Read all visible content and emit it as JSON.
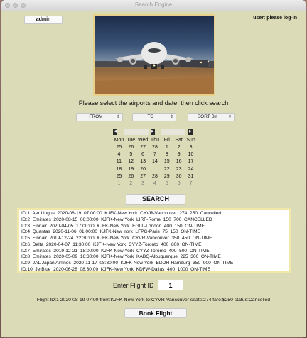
{
  "window": {
    "title": "Search Engine"
  },
  "header": {
    "admin_label": "admin",
    "user_status": "user: please log-in"
  },
  "instruction": "Please select the airports and date, then click search",
  "dropdowns": {
    "from": "FROM",
    "to": "TO",
    "sort": "SORT BY"
  },
  "calendar": {
    "weekdays": [
      "Mon",
      "Tue",
      "Wed",
      "Thu",
      "Fri",
      "Sat",
      "Sun"
    ],
    "weeks": [
      [
        "25",
        "26",
        "27",
        "28",
        "1",
        "2",
        "3"
      ],
      [
        "4",
        "5",
        "6",
        "7",
        "8",
        "9",
        "10"
      ],
      [
        "11",
        "12",
        "13",
        "14",
        "15",
        "16",
        "17"
      ],
      [
        "18",
        "19",
        "20",
        "",
        "22",
        "23",
        "24"
      ],
      [
        "25",
        "26",
        "27",
        "28",
        "29",
        "30",
        "31"
      ],
      [
        "1",
        "2",
        "3",
        "4",
        "5",
        "6",
        "7"
      ]
    ]
  },
  "search_label": "SEARCH",
  "results": [
    "ID:1  Aer Lingus  2020-08-19  07:00:00  KJFK-New York  CYVR-Vancouver  274  250  Cancelled",
    "ID:2  Emirates  2020-08-15  06:00:00  KJFK-New York  LIRF-Rome  150  700  CANCELLED",
    "ID:3  Finnair  2020-04-05  17:00:00  KJFK-New York  EGLL-London  400  150  ON-TIME",
    "ID:4  Quantas  2020-11-06  01:00:00  KJFK-New York  LFPG-Paris  75  150  ON-TIME",
    "ID:5  Finnair  2019-12-24  22:30:00  KJFK-New York  CYVR-Vancouver  350  450  ON-TIME",
    "ID:6  Delta  2020-04-07  11:30:00  KJFK-New York  CYYZ-Toronto  400  800  ON-TIME",
    "ID:7  Emirates  2019-12-21  18:00:00  KJFK-New York  CYYZ-Toronto  400  500  ON-TIME",
    "ID:8  Emirates  2020-05-09  16:30:00  KJFK-New York  KABQ-Albuquerque  225  300  ON-TIME",
    "ID:9  JAL Japan Airlines  2020-11-17  08:30:00  KJFK-New York  EDDH-Hamburg  350  900  ON-TIME",
    "ID:10  JetBlue  2020-06-28  08:30:00  KJFK-New York  KDFW-Dallas  400  1000  ON-TIME"
  ],
  "flight_id": {
    "label": "Enter Flight ID",
    "value": "1"
  },
  "details": "Flight ID:1  2020-08-19  07:00  from:KJFK-New York  to:CYVR-Vancouver  seats:274  fare:$250  status:Cancelled",
  "book_label": "Book Flight"
}
